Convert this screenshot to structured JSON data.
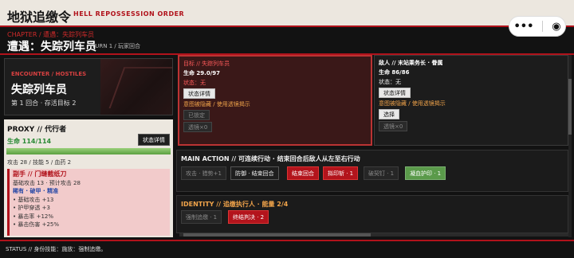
{
  "header": {
    "title": "地狱追缴令",
    "subtitle": "HELL REPOSSESSION ORDER"
  },
  "capsule": {
    "menu_glyph": "•••",
    "close_glyph": "◉"
  },
  "chapter": {
    "label": "CHAPTER / 遭遇：失踪列车员",
    "title": "遭遇：失踪列车员",
    "turn": "TURN 1 / 玩家回合"
  },
  "encounter": {
    "head": "ENCOUNTER / HOSTILES",
    "name": "失踪列车员",
    "sub": "第 1 回合 · 存活目标 2"
  },
  "proxy": {
    "title": "PROXY // 代行者",
    "hp": "生命 114/114",
    "hp_fraction": 1.0,
    "state_button": "状态详情",
    "stats": "攻击 28 / 技能 5 / 血药 2",
    "weapon": {
      "name": "副手 // 门缝截纸刀",
      "line1": "基础攻击 13 · 预计攻击 28",
      "tags": "稀有 · 破甲 · 精准",
      "bullets": [
        "• 基础攻击 +13",
        "• 护甲穿透 +3",
        "• 暴击率 +12%",
        "• 暴击伤害 +25%"
      ]
    }
  },
  "enemies": [
    {
      "title": "目标 // 失踪列车员",
      "hp": "生命 29.0/97",
      "state": "状态：无",
      "detail_btn": "状态详情",
      "intent": "意图被隐藏 / 使用透镜揭示",
      "action_btn": "已锁定",
      "lens_btn": "透镜×0"
    },
    {
      "title": "敌人 // 末站乘务长 · 眷属",
      "hp": "生命 86/86",
      "state": "状态：无",
      "detail_btn": "状态详情",
      "intent": "意图被隐藏 / 使用透镜揭示",
      "action_btn": "选择",
      "lens_btn": "透镜×0"
    }
  ],
  "main_action": {
    "title": "MAIN ACTION // 可连续行动 · 结束回合后敌人从左至右行动",
    "buttons": [
      {
        "label": "攻击 · 猎势+1",
        "style": "dim"
      },
      {
        "label": "防御 · 结束回合",
        "style": "dark"
      },
      {
        "label": "结束回合",
        "style": "red"
      },
      {
        "label": "拟印斩 · 1",
        "style": "red"
      },
      {
        "label": "破契钉 · 1",
        "style": "dim"
      },
      {
        "label": "凝血护印 · 1",
        "style": "green"
      }
    ]
  },
  "identity": {
    "title": "IDENTITY // 追缴执行人 · 能量 2/4",
    "buttons": [
      {
        "label": "强制追缴 · 1",
        "style": "dim"
      },
      {
        "label": "终结判决 · 2",
        "style": "red"
      }
    ]
  },
  "status": "STATUS // 身份技能：施放：强制追缴。",
  "colors": {
    "accent": "#b1121b",
    "hp_green": "#2a8a35",
    "intent_orange": "#f0a34a"
  }
}
